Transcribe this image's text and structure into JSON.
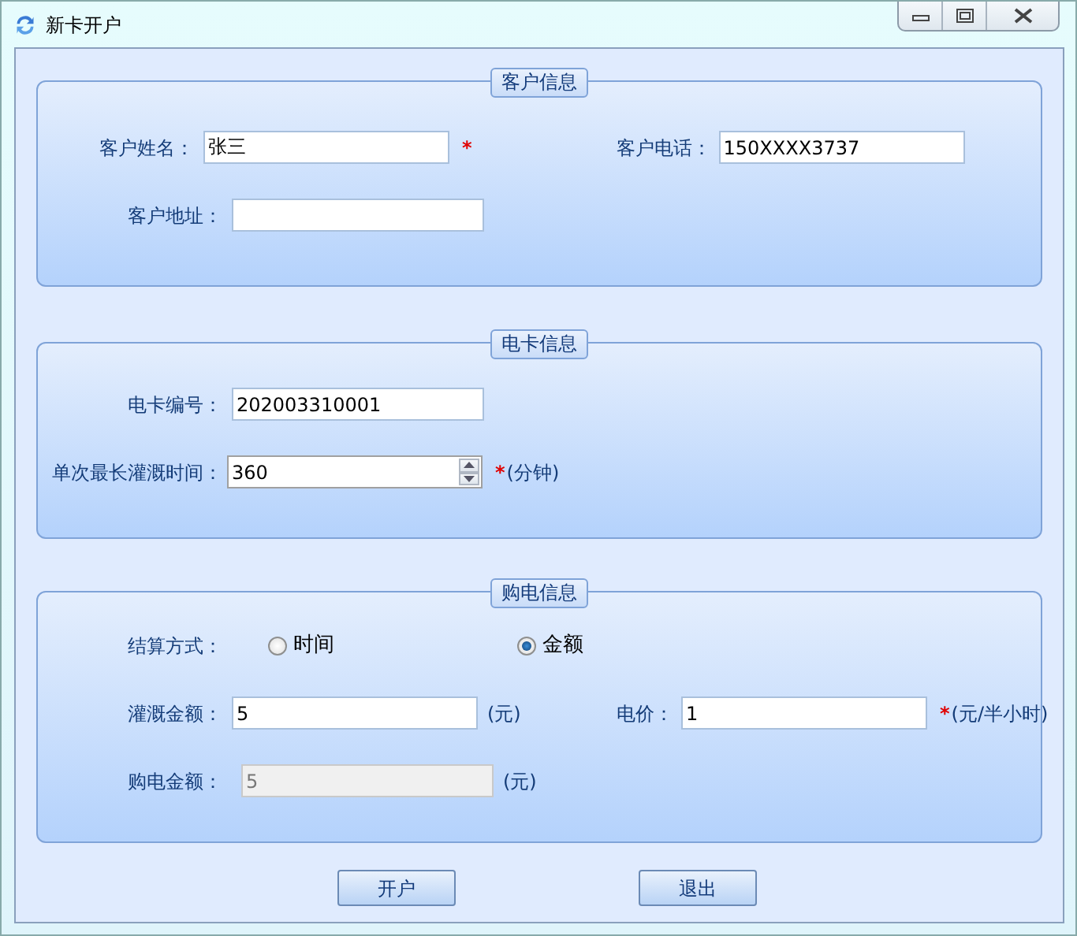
{
  "window": {
    "title": "新卡开户"
  },
  "sections": [
    {
      "title": "客户信息",
      "rows": [
        {
          "fields": [
            {
              "kind": "text",
              "label": "客户姓名：",
              "value": "张三",
              "mark": "*"
            },
            {
              "kind": "text",
              "label": "客户电话：",
              "value": "150XXXX3737"
            }
          ]
        },
        {
          "fields": [
            {
              "kind": "text",
              "label": "客户地址："
            }
          ]
        }
      ]
    },
    {
      "title": "电卡信息",
      "rows": [
        {
          "fields": [
            {
              "kind": "text",
              "label": "电卡编号：",
              "value": "202003310001"
            }
          ]
        },
        {
          "fields": [
            {
              "kind": "spin",
              "label": "单次最长灌溉时间：",
              "value": "360",
              "mark": "*",
              "suffix": "(分钟)"
            }
          ]
        }
      ]
    },
    {
      "title": "购电信息",
      "rows": [
        {
          "fields": [
            {
              "kind": "radio",
              "label": "结算方式：",
              "options": [
                {
                  "label": "时间",
                  "selected": false
                },
                {
                  "label": "金额",
                  "selected": true
                }
              ]
            }
          ]
        },
        {
          "fields": [
            {
              "kind": "text",
              "label": "灌溉金额：",
              "value": "5",
              "suffix": "(元)"
            },
            {
              "kind": "text",
              "label": "电价：",
              "value": "1",
              "mark": "*",
              "suffix": "(元/半小时)"
            }
          ]
        },
        {
          "fields": [
            {
              "kind": "text",
              "label": "购电金额：",
              "value": "5",
              "disabled": true,
              "suffix": "(元)"
            }
          ]
        }
      ]
    }
  ],
  "buttons": [
    "开户",
    "退出"
  ]
}
